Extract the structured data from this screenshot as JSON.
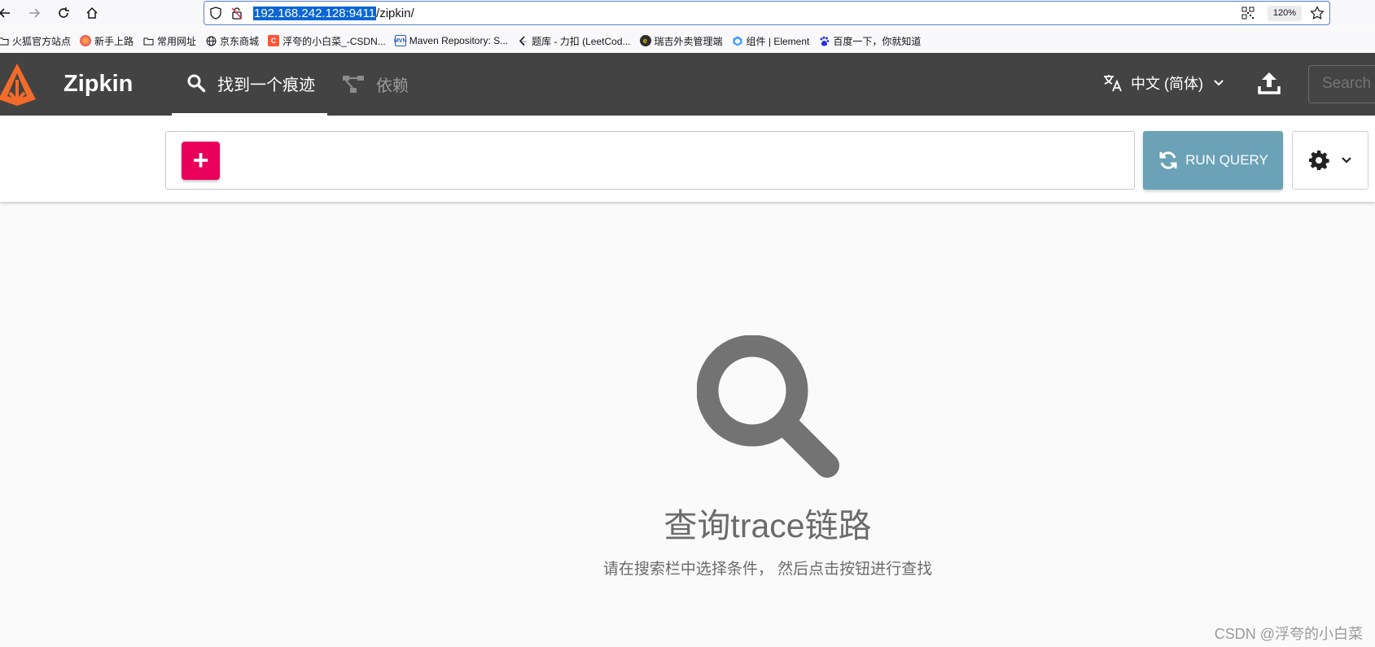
{
  "browser": {
    "url_host": "192.168.242.128:9411",
    "url_path": "/zipkin/",
    "zoom": "120%",
    "bookmarks": [
      {
        "label": "火狐官方站点",
        "icon": "folder-icon"
      },
      {
        "label": "新手上路",
        "icon": "firefox-icon"
      },
      {
        "label": "常用网址",
        "icon": "folder-icon"
      },
      {
        "label": "京东商城",
        "icon": "globe-icon"
      },
      {
        "label": "浮夸的小白菜_-CSDN...",
        "icon": "csdn-icon"
      },
      {
        "label": "Maven Repository: S...",
        "icon": "mvn-icon"
      },
      {
        "label": "题库 - 力扣 (LeetCod...",
        "icon": "leetcode-icon"
      },
      {
        "label": "瑞吉外卖管理端",
        "icon": "reggie-icon"
      },
      {
        "label": "组件 | Element",
        "icon": "element-icon"
      },
      {
        "label": "百度一下，你就知道",
        "icon": "baidu-icon"
      }
    ]
  },
  "app": {
    "title": "Zipkin",
    "tabs": {
      "find": "找到一个痕迹",
      "dependencies": "依赖"
    },
    "language": "中文 (简体)",
    "search_placeholder": "Search"
  },
  "query": {
    "add_label": "+",
    "run_label": "RUN QUERY"
  },
  "empty_state": {
    "title": "查询trace链路",
    "subtitle": "请在搜索栏中选择条件， 然后点击按钮进行查找"
  },
  "watermark": "CSDN @浮夸的小白菜",
  "colors": {
    "header_bg": "#434343",
    "add_button": "#e8005a",
    "run_button": "#6ba2b8",
    "logo_orange": "#f26b2b"
  }
}
